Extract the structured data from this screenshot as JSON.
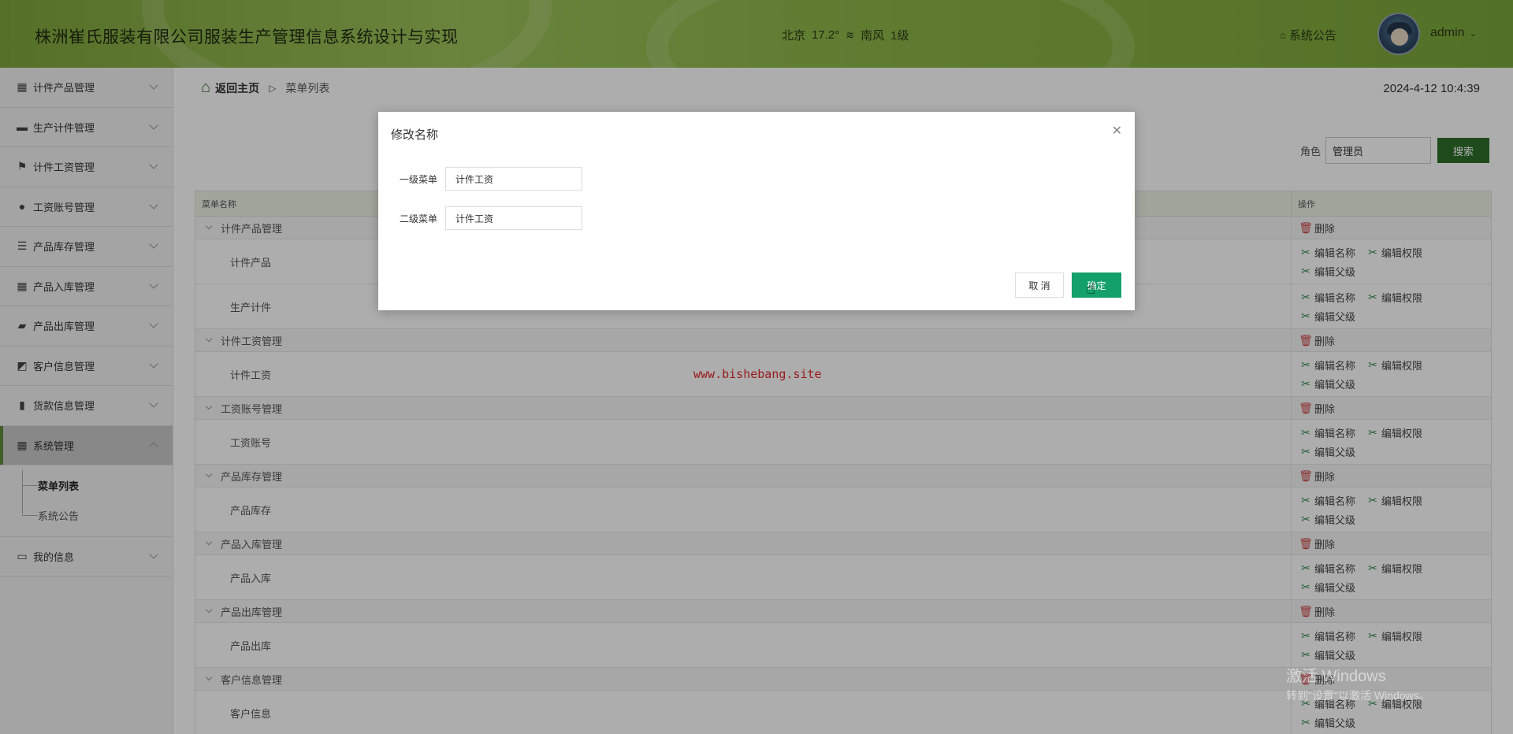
{
  "header": {
    "title": "株洲崔氏服装有限公司服装生产管理信息系统设计与实现",
    "weather": {
      "city": "北京",
      "temp": "17.2°",
      "icon": "haze-icon",
      "wind": "南风",
      "level": "1级"
    },
    "announcement": "系统公告",
    "user": "admin"
  },
  "sidebar": {
    "items": [
      {
        "label": "计件产品管理",
        "icon": "grid-icon"
      },
      {
        "label": "生产计件管理",
        "icon": "monitor-icon"
      },
      {
        "label": "计件工资管理",
        "icon": "flag-icon"
      },
      {
        "label": "工资账号管理",
        "icon": "leaf-icon"
      },
      {
        "label": "产品库存管理",
        "icon": "sliders-icon"
      },
      {
        "label": "产品入库管理",
        "icon": "grid-icon"
      },
      {
        "label": "产品出库管理",
        "icon": "briefcase-icon"
      },
      {
        "label": "客户信息管理",
        "icon": "chart-line-icon"
      },
      {
        "label": "货款信息管理",
        "icon": "bar-chart-icon"
      },
      {
        "label": "系统管理",
        "icon": "grid-icon"
      }
    ],
    "sub_items": [
      "菜单列表",
      "系统公告"
    ],
    "last_item": {
      "label": "我的信息",
      "icon": "card-icon"
    }
  },
  "main": {
    "breadcrumb": {
      "home": "返回主页",
      "current": "菜单列表"
    },
    "datetime": "2024-4-12 10:4:39",
    "filter": {
      "label": "角色",
      "value": "管理员",
      "button": "搜索"
    },
    "table": {
      "headers": [
        "菜单名称",
        "操作"
      ],
      "actions": {
        "delete": "删除",
        "edit_name": "编辑名称",
        "edit_perm": "编辑权限",
        "edit_parent": "编辑父级"
      },
      "groups": [
        {
          "parent": "计件产品管理",
          "children": [
            "计件产品",
            "生产计件"
          ]
        },
        {
          "parent": "计件工资管理",
          "children": [
            "计件工资"
          ]
        },
        {
          "parent": "工资账号管理",
          "children": [
            "工资账号"
          ]
        },
        {
          "parent": "产品库存管理",
          "children": [
            "产品库存"
          ]
        },
        {
          "parent": "产品入库管理",
          "children": [
            "产品入库"
          ]
        },
        {
          "parent": "产品出库管理",
          "children": [
            "产品出库"
          ]
        },
        {
          "parent": "客户信息管理",
          "children": [
            "客户信息"
          ]
        }
      ]
    }
  },
  "modal": {
    "title": "修改名称",
    "field1": {
      "label": "一级菜单",
      "value": "计件工资"
    },
    "field2": {
      "label": "二级菜单",
      "value": "计件工资"
    },
    "cancel": "取 消",
    "ok": "确定"
  },
  "watermark": "www.bishebang.site",
  "windows": {
    "line1": "激活 Windows",
    "line2": "转到\"设置\"以激活 Windows。"
  }
}
